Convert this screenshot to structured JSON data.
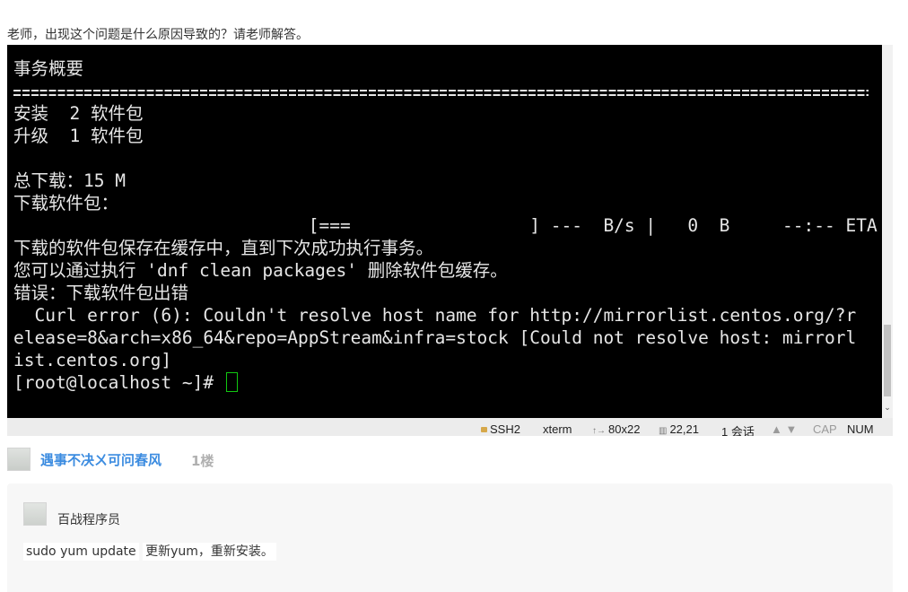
{
  "question": {
    "text": "老师，出现这个问题是什么原因导致的？请老师解答。"
  },
  "terminal": {
    "lines": [
      "事务概要",
      "",
      "安装  2 软件包",
      "升级  1 软件包",
      "",
      "总下载：15 M",
      "下载软件包：",
      "                            [===                 ] ---  B/s |   0  B     --:-- ETA",
      "下载的软件包保存在缓存中，直到下次成功执行事务。",
      "您可以通过执行 'dnf clean packages' 删除软件包缓存。",
      "错误：下载软件包出错",
      "  Curl error (6): Couldn't resolve host name for http://mirrorlist.centos.org/?r",
      "elease=8&arch=x86_64&repo=AppStream&infra=stock [Could not resolve host: mirrorl",
      "ist.centos.org]",
      "[root@localhost ~]# "
    ],
    "separator": "================================================================================",
    "cursor_color": "#11c811"
  },
  "statusbar": {
    "protocol": "SSH2",
    "terminal_type": "xterm",
    "size": "80x22",
    "cursor_pos": "22,21",
    "sessions": "1 会话",
    "cap": "CAP",
    "num": "NUM"
  },
  "reply": {
    "username": "遇事不决ㄨ可问春风",
    "floor": "1楼",
    "username_color": "#3c8ce0"
  },
  "answer": {
    "author": "百战程序员",
    "code_text": "sudo yum update",
    "text_rest": "更新yum，重新安装。"
  },
  "icons": [
    "lock-icon",
    "resize-icon",
    "cursor-position-icon",
    "scroll-up-icon",
    "scroll-down-icon",
    "avatar",
    "chevron-down-icon"
  ]
}
